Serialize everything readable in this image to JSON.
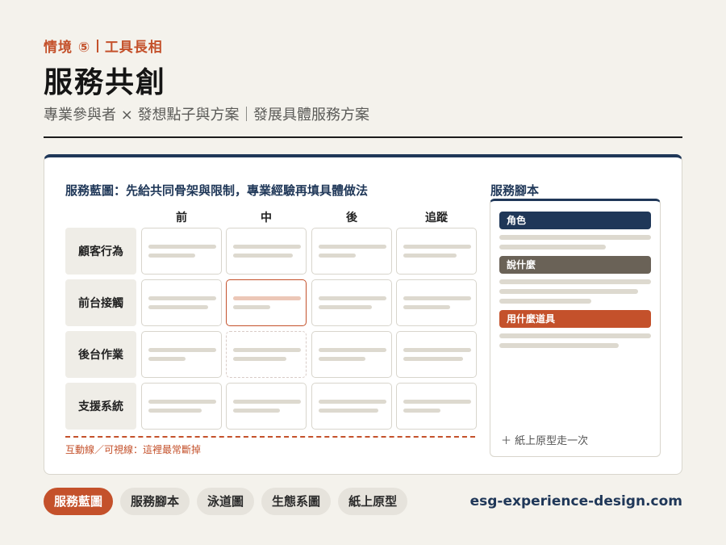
{
  "header": {
    "eyebrow_left": "情境 ⑤",
    "eyebrow_right": "工具長相",
    "title": "服務共創",
    "subtitle_left": "專業參與者 × 發想點子與方案",
    "subtitle_right": "發展具體服務方案"
  },
  "blueprint": {
    "title": "服務藍圖：先給共同骨架與限制，專業經驗再填具體做法",
    "columns": [
      "前",
      "中",
      "後",
      "追蹤"
    ],
    "rows": [
      "顧客行為",
      "前台接觸",
      "後台作業",
      "支援系統"
    ],
    "note": "互動線／可視線：這裡最常斷掉"
  },
  "script": {
    "title": "服務腳本",
    "tags": [
      {
        "label": "角色",
        "color": "#1f3758"
      },
      {
        "label": "說什麼",
        "color": "#6a6257"
      },
      {
        "label": "用什麼道具",
        "color": "#c4512b"
      }
    ],
    "footer": "＋ 紙上原型走一次"
  },
  "tabs": [
    {
      "label": "服務藍圖",
      "active": true
    },
    {
      "label": "服務腳本",
      "active": false
    },
    {
      "label": "泳道圖",
      "active": false
    },
    {
      "label": "生態系圖",
      "active": false
    },
    {
      "label": "紙上原型",
      "active": false
    }
  ],
  "site": "esg-experience-design.com",
  "colors": {
    "accent": "#c4512b",
    "navy": "#1f3758",
    "bg": "#f4f2ec"
  }
}
